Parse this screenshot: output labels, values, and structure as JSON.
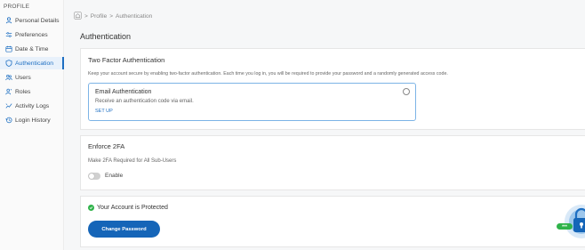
{
  "sidebar": {
    "heading": "PROFILE",
    "items": [
      {
        "label": "Personal Details",
        "icon": "user-icon",
        "active": false
      },
      {
        "label": "Preferences",
        "icon": "sliders-icon",
        "active": false
      },
      {
        "label": "Date & Time",
        "icon": "calendar-icon",
        "active": false
      },
      {
        "label": "Authentication",
        "icon": "shield-icon",
        "active": true
      },
      {
        "label": "Users",
        "icon": "users-icon",
        "active": false
      },
      {
        "label": "Roles",
        "icon": "roles-icon",
        "active": false
      },
      {
        "label": "Activity Logs",
        "icon": "activity-icon",
        "active": false
      },
      {
        "label": "Login History",
        "icon": "history-icon",
        "active": false
      }
    ]
  },
  "breadcrumb": {
    "home_icon": "home-icon",
    "items": [
      "Profile",
      "Authentication"
    ],
    "separator": ">"
  },
  "page": {
    "title": "Authentication"
  },
  "two_factor": {
    "title": "Two Factor Authentication",
    "description": "Keep your account secure by enabling two-factor authentication. Each time you log in, you will be required to provide your password and a randomly generated access code.",
    "email_option": {
      "title": "Email Authentication",
      "description": "Receive an authentication code via email.",
      "setup_label": "SET UP",
      "selected": false
    }
  },
  "enforce": {
    "title": "Enforce 2FA",
    "description": "Make 2FA Required for All Sub-Users",
    "toggle_label": "Enable",
    "enabled": false
  },
  "protection": {
    "status_text": "Your Account is Protected",
    "button_label": "Change Password"
  },
  "colors": {
    "accent": "#1e6fc2",
    "button": "#1565b8",
    "success": "#2fb34a"
  }
}
